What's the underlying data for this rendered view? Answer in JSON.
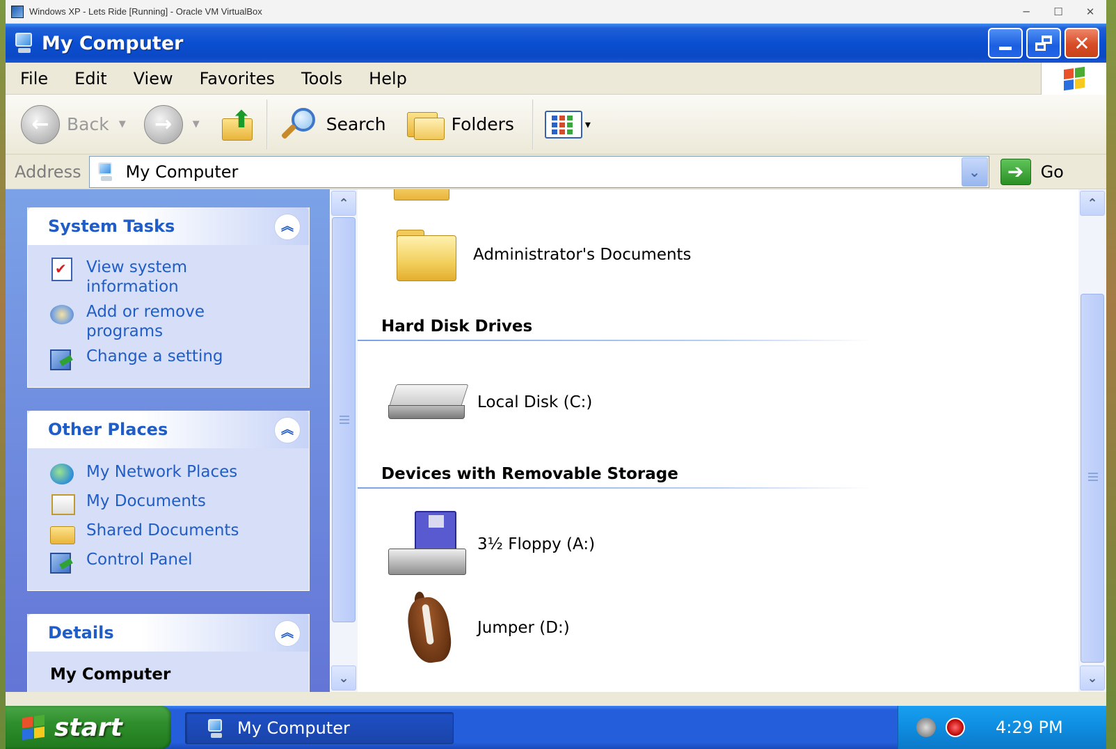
{
  "host": {
    "title": "Windows XP - Lets Ride [Running] - Oracle VM VirtualBox",
    "controls": {
      "minimize": "─",
      "maximize": "☐",
      "close": "✕"
    }
  },
  "window": {
    "title": "My Computer",
    "title_bar_color": "#0a4fd2",
    "buttons": {
      "minimize": "",
      "restore": "",
      "close": "✕"
    }
  },
  "menu": {
    "items": [
      "File",
      "Edit",
      "View",
      "Favorites",
      "Tools",
      "Help"
    ]
  },
  "toolbar": {
    "back_label": "Back",
    "back_icon": "←",
    "forward_icon": "→",
    "up_icon": "⬆",
    "search_label": "Search",
    "folders_label": "Folders",
    "views_caret": "▾",
    "drop_caret": "▼"
  },
  "address": {
    "label": "Address",
    "value": "My Computer",
    "dropdown_icon": "⌄",
    "go_icon": "➔",
    "go_label": "Go"
  },
  "task_pane": {
    "collapse_icon": "︽",
    "system_tasks": {
      "title": "System Tasks",
      "links": [
        "View system information",
        "Add or remove programs",
        "Change a setting"
      ]
    },
    "other_places": {
      "title": "Other Places",
      "links": [
        "My Network Places",
        "My Documents",
        "Shared Documents",
        "Control Panel"
      ]
    },
    "details": {
      "title": "Details",
      "item_title": "My Computer"
    }
  },
  "content": {
    "folders": [
      {
        "label": "Administrator's Documents",
        "icon": "folder-icon"
      }
    ],
    "groups": {
      "hard_disks": {
        "title": "Hard Disk Drives",
        "items": [
          {
            "label": "Local Disk (C:)",
            "icon": "hard-disk-icon"
          }
        ]
      },
      "removable": {
        "title": "Devices with Removable Storage",
        "items": [
          {
            "label": "3½ Floppy (A:)",
            "icon": "floppy-drive-icon"
          },
          {
            "label": "Jumper (D:)",
            "icon": "horse-drive-icon"
          }
        ]
      }
    }
  },
  "scroll": {
    "up_icon": "⌃",
    "down_icon": "⌄"
  },
  "taskbar": {
    "start_label": "start",
    "task_label": "My Computer",
    "clock": "4:29 PM",
    "colors": {
      "start": "#2f8e2c",
      "bar": "#245edb",
      "tray": "#0f8de0"
    }
  }
}
